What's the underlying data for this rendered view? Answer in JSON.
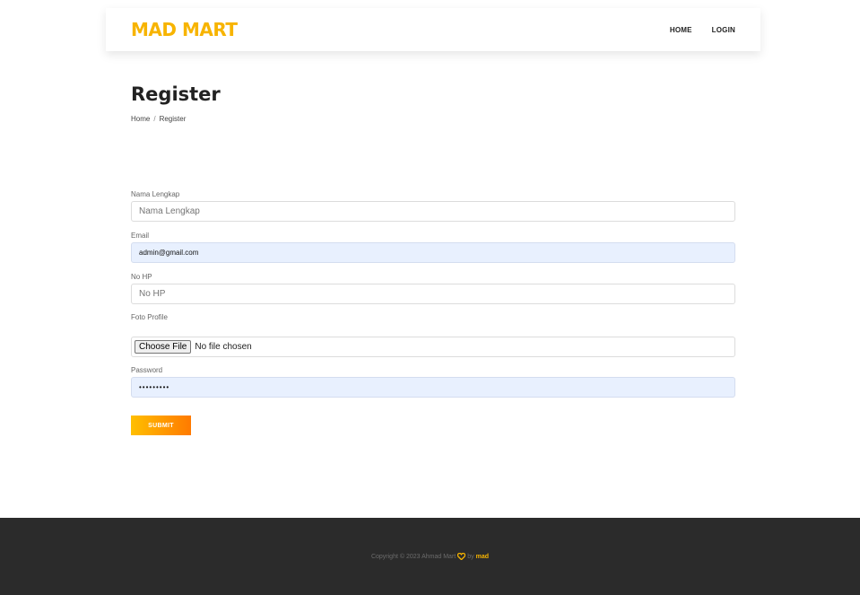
{
  "header": {
    "brand": "MAD MART",
    "nav": {
      "home": "HOME",
      "login": "LOGIN"
    }
  },
  "page": {
    "title": "Register",
    "breadcrumb": {
      "home": "Home",
      "separator": "/",
      "current": "Register"
    }
  },
  "form": {
    "full_name": {
      "label": "Nama Lengkap",
      "placeholder": "Nama Lengkap",
      "value": ""
    },
    "email": {
      "label": "Email",
      "value": "admin@gmail.com"
    },
    "phone": {
      "label": "No HP",
      "placeholder": "No HP",
      "value": ""
    },
    "photo": {
      "label": "Foto Profile",
      "button": "Choose File",
      "status": "No file chosen"
    },
    "password": {
      "label": "Password",
      "value": "•••••••••"
    },
    "submit": "SUBMIT"
  },
  "footer": {
    "copyright": "Copyright © 2023 Ahmad Mart",
    "by": "by",
    "author": "mad",
    "heart_color": "#f7b400"
  },
  "colors": {
    "brand": "#f7b400",
    "submit_start": "#ffbf00",
    "submit_end": "#ff7a00",
    "footer_bg": "#2b2b2b"
  }
}
